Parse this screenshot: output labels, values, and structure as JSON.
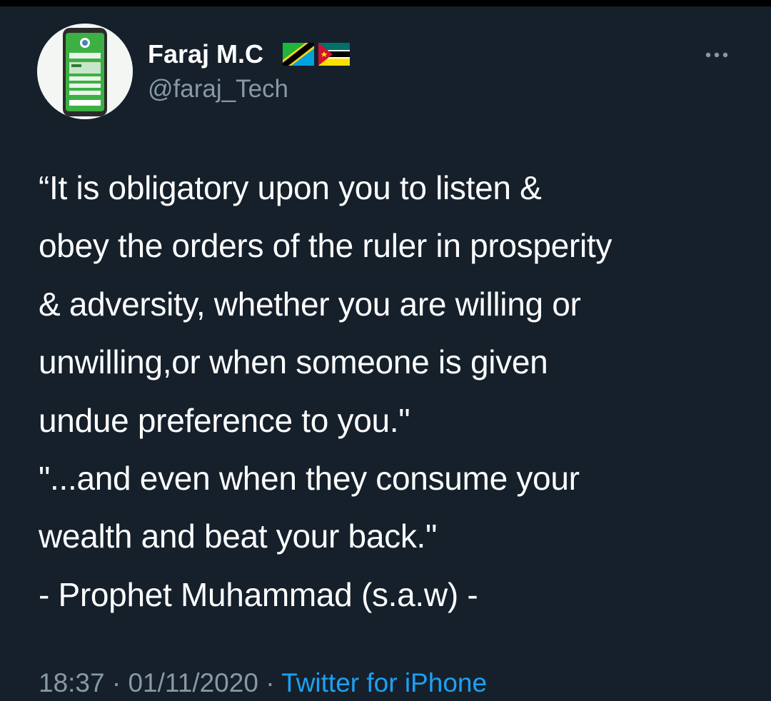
{
  "tweet": {
    "author": {
      "display_name": "Faraj M.C",
      "handle": "@faraj_Tech",
      "flags": [
        "tanzania-flag",
        "mozambique-flag"
      ],
      "avatar_icon": "phone-app-avatar-icon"
    },
    "more_icon": "more-horizontal-icon",
    "text_lines": [
      "“It is obligatory upon you to listen &",
      "obey the orders of the ruler in prosperity",
      "& adversity, whether you are willing or",
      "unwilling,or when someone is given",
      "undue preference to you.\"",
      "\"...and even when they consume your",
      "wealth and beat your back.\"",
      "- Prophet Muhammad (s.a.w) -"
    ],
    "time": "18:37",
    "separator": " · ",
    "date": "01/11/2020",
    "source": "Twitter for iPhone"
  },
  "colors": {
    "background": "#15202b",
    "text_primary": "#ffffff",
    "text_secondary": "#8899a6",
    "link": "#1da1f2"
  }
}
